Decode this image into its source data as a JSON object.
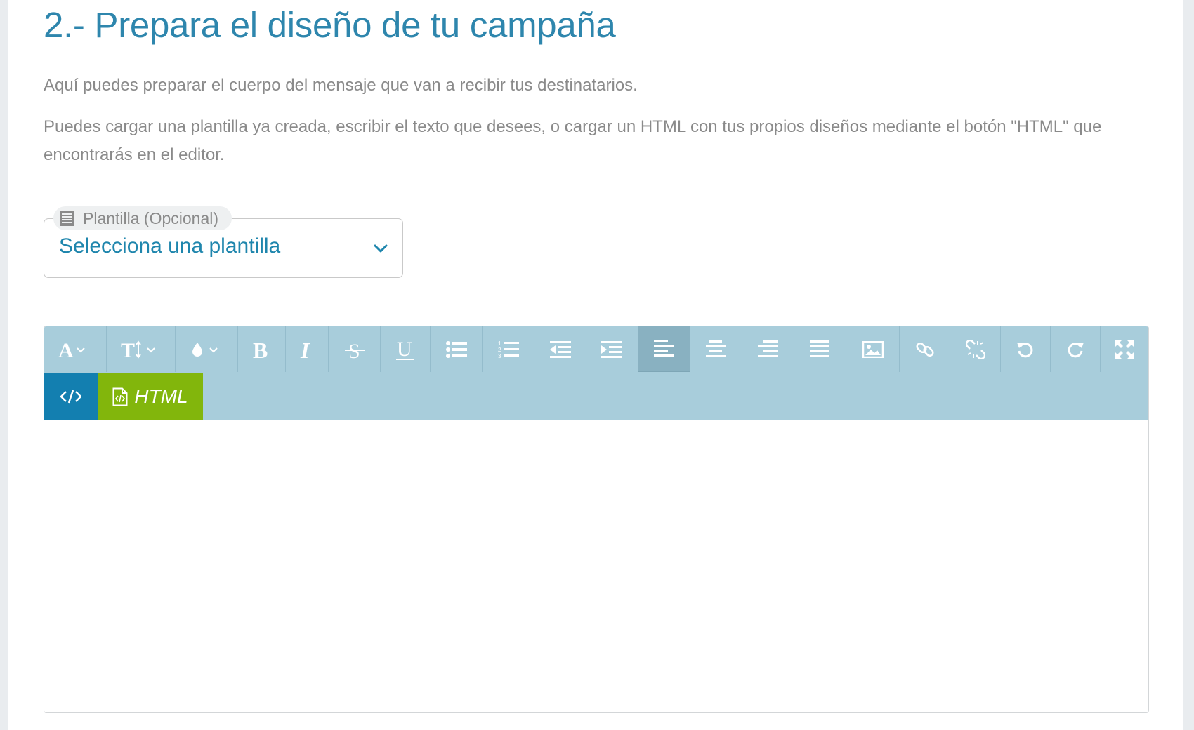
{
  "section": {
    "title": "2.- Prepara el diseño de tu campaña",
    "intro_1": "Aquí puedes preparar el cuerpo del mensaje que van a recibir tus destinatarios.",
    "intro_2": "Puedes cargar una plantilla ya creada, escribir el texto que desees, o cargar un HTML con tus propios diseños mediante el botón \"HTML\" que encontrarás en el editor."
  },
  "template_select": {
    "label": "Plantilla (Opcional)",
    "label_icon": "document-icon",
    "value": "Selecciona una plantilla",
    "chevron_icon": "chevron-down-icon",
    "accent_color": "#1f86ad"
  },
  "editor": {
    "toolbar_color": "#a8cddb",
    "toolbar": [
      {
        "name": "font-family-button",
        "icon": "font-family-icon"
      },
      {
        "name": "font-size-button",
        "icon": "font-size-icon"
      },
      {
        "name": "text-color-button",
        "icon": "color-drop-icon"
      },
      {
        "name": "bold-button",
        "icon": "bold-icon"
      },
      {
        "name": "italic-button",
        "icon": "italic-icon"
      },
      {
        "name": "strikethrough-button",
        "icon": "strikethrough-icon"
      },
      {
        "name": "underline-button",
        "icon": "underline-icon"
      },
      {
        "name": "bullet-list-button",
        "icon": "bullet-list-icon"
      },
      {
        "name": "numbered-list-button",
        "icon": "numbered-list-icon"
      },
      {
        "name": "outdent-button",
        "icon": "outdent-icon"
      },
      {
        "name": "indent-button",
        "icon": "indent-icon"
      },
      {
        "name": "align-left-button",
        "icon": "align-left-icon",
        "active": true
      },
      {
        "name": "align-center-button",
        "icon": "align-center-icon"
      },
      {
        "name": "align-right-button",
        "icon": "align-right-icon"
      },
      {
        "name": "align-justify-button",
        "icon": "align-justify-icon"
      },
      {
        "name": "insert-image-button",
        "icon": "image-icon"
      },
      {
        "name": "insert-link-button",
        "icon": "link-icon"
      },
      {
        "name": "unlink-button",
        "icon": "unlink-icon"
      },
      {
        "name": "undo-button",
        "icon": "undo-icon"
      },
      {
        "name": "redo-button",
        "icon": "redo-icon"
      },
      {
        "name": "fullscreen-button",
        "icon": "fullscreen-icon"
      }
    ],
    "code_view_icon": "code-icon",
    "code_view_color": "#137fb0",
    "html_button_label": "HTML",
    "html_button_icon": "html-file-icon",
    "html_button_color": "#82b60c",
    "content": ""
  }
}
